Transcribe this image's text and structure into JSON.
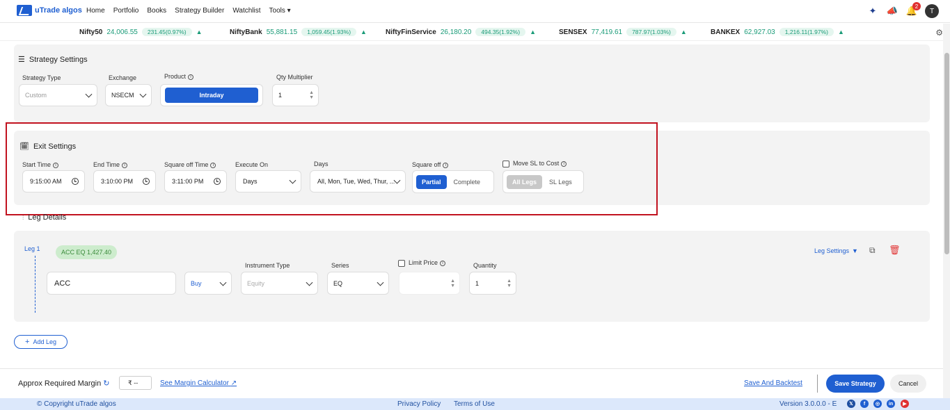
{
  "nav": {
    "logo_text": "uTrade algos",
    "menu": [
      "Home",
      "Portfolio",
      "Books",
      "Strategy Builder",
      "Watchlist",
      "Tools"
    ],
    "notification_count": "2",
    "avatar_letter": "T"
  },
  "ticker": [
    {
      "name": "Nifty50",
      "value": "24,006.55",
      "change": "231.45(0.97%)"
    },
    {
      "name": "NiftyBank",
      "value": "55,881.15",
      "change": "1,059.45(1.93%)"
    },
    {
      "name": "NiftyFinService",
      "value": "26,180.20",
      "change": "494.35(1.92%)"
    },
    {
      "name": "SENSEX",
      "value": "77,419.61",
      "change": "787.97(1.03%)"
    },
    {
      "name": "BANKEX",
      "value": "62,927.03",
      "change": "1,216.11(1.97%)"
    }
  ],
  "strategy_settings": {
    "title": "Strategy Settings",
    "strategy_type_label": "Strategy Type",
    "strategy_type_value": "Custom",
    "exchange_label": "Exchange",
    "exchange_value": "NSECM",
    "product_label": "Product",
    "product_value": "Intraday",
    "qty_label": "Qty Multiplier",
    "qty_value": "1"
  },
  "exit_settings": {
    "title": "Exit Settings",
    "start_time_label": "Start Time",
    "start_time": "9:15:00 AM",
    "end_time_label": "End Time",
    "end_time": "3:10:00 PM",
    "square_off_time_label": "Square off Time",
    "square_off_time": "3:11:00 PM",
    "execute_on_label": "Execute On",
    "execute_on": "Days",
    "days_label": "Days",
    "days_value": "All, Mon, Tue, Wed, Thur, ...",
    "square_off_label": "Square off",
    "square_off_options": [
      "Partial",
      "Complete"
    ],
    "move_sl_label": "Move SL to Cost",
    "move_sl_options": [
      "All Legs",
      "SL Legs"
    ]
  },
  "leg_details": {
    "title": "Leg Details",
    "leg_label": "Leg 1",
    "leg_chip": "ACC EQ 1,427.40",
    "leg_settings": "Leg Settings",
    "instrument": "ACC",
    "side": "Buy",
    "instrument_type_label": "Instrument Type",
    "instrument_type": "Equity",
    "series_label": "Series",
    "series": "EQ",
    "limit_price_label": "Limit Price",
    "quantity_label": "Quantity",
    "quantity": "1",
    "add_leg": "Add Leg"
  },
  "footer": {
    "margin_label": "Approx Required Margin",
    "margin_value": "₹ --",
    "margin_calc": "See Margin Calculator",
    "save_backtest": "Save And Backtest",
    "save_strategy": "Save Strategy",
    "cancel": "Cancel"
  },
  "copyright": {
    "text": "© Copyright uTrade algos",
    "privacy": "Privacy Policy",
    "terms": "Terms of Use",
    "version": "Version 3.0.0.0 - E"
  },
  "colors": {
    "accent": "#1f5fd1",
    "positive": "#1a9b78",
    "highlight": "#c1121f"
  }
}
